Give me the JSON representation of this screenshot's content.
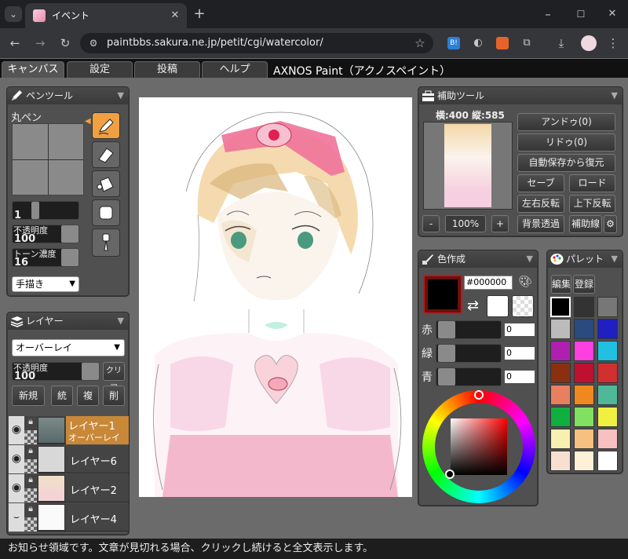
{
  "browser": {
    "tab_title": "イベント",
    "url": "paintbbs.sakura.ne.jp/petit/cgi/watercolor/"
  },
  "app_tabs": [
    "キャンバス",
    "設定",
    "投稿",
    "ヘルプ"
  ],
  "app_title": "AXNOS Paint（アクノスペイント）",
  "pen_panel": {
    "title": "ペンツール",
    "brush_name": "丸ペン",
    "size_label": "太さ",
    "size_value": "1",
    "opacity_label": "不透明度",
    "opacity_value": "100",
    "tone_label": "トーン濃度",
    "tone_value": "16",
    "mode_select": "手描き"
  },
  "layer_panel": {
    "title": "レイヤー",
    "blend_select": "オーバーレイ",
    "opacity_label": "不透明度",
    "opacity_value": "100",
    "clear_button": "クリア",
    "buttons": [
      "新規",
      "統",
      "複",
      "削"
    ],
    "layers": [
      {
        "name": "レイヤー1",
        "sub": "オーバーレイ",
        "active": true
      },
      {
        "name": "レイヤー6",
        "sub": "",
        "active": false
      },
      {
        "name": "レイヤー2",
        "sub": "",
        "active": false
      },
      {
        "name": "レイヤー4",
        "sub": "",
        "active": false
      }
    ]
  },
  "aux_panel": {
    "title": "補助ツール",
    "size_info": "横:400 縦:585",
    "zoom": "100%",
    "minus": "-",
    "plus": "+",
    "undo": "アンドゥ(0)",
    "redo": "リドゥ(0)",
    "autosave_restore": "自動保存から復元",
    "save": "セーブ",
    "load": "ロード",
    "flip_h": "左右反転",
    "flip_v": "上下反転",
    "bg_transparent": "背景透過",
    "aux_line": "補助線"
  },
  "color_panel": {
    "title": "色作成",
    "hex": "#000000",
    "red_label": "赤",
    "green_label": "緑",
    "blue_label": "青",
    "red_value": "0",
    "green_value": "0",
    "blue_value": "0",
    "current_color": "#000000"
  },
  "palette_panel": {
    "title": "パレット",
    "edit": "編集",
    "register": "登録",
    "colors": [
      "#000000",
      "#333333",
      "#777777",
      "#bbbbbb",
      "#2a4a80",
      "#2020c0",
      "#b020b0",
      "#ff40e0",
      "#20c0e0",
      "#8a3010",
      "#c01030",
      "#d03030",
      "#e88060",
      "#f08820",
      "#50b898",
      "#10b040",
      "#80e060",
      "#f0f040",
      "#f8f0b0",
      "#f8c080",
      "#f8c0c0",
      "#f8e0d0",
      "#fff0d8",
      "#ffffff"
    ]
  },
  "status_text": "お知らせ領域です。文章が見切れる場合、クリックし続けると全文表示します。"
}
